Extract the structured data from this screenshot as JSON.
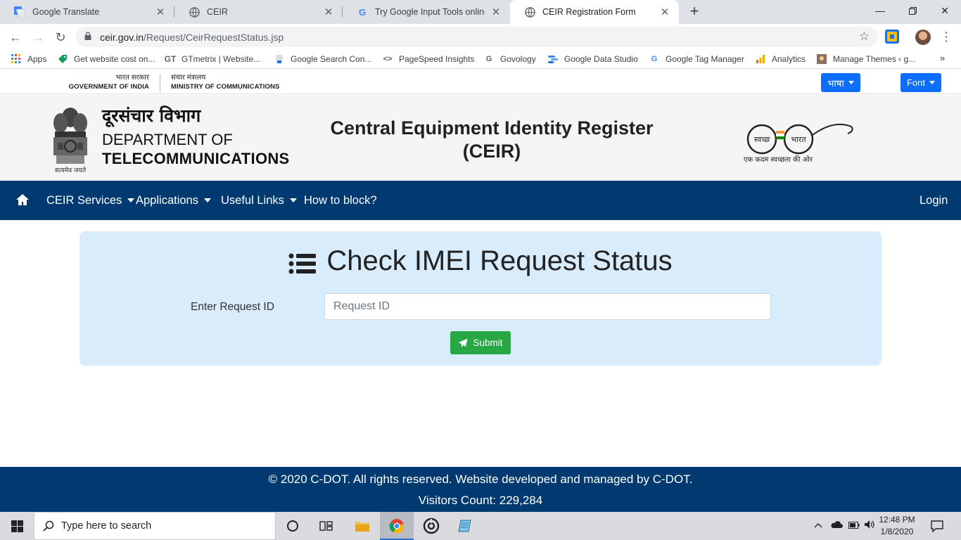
{
  "browser": {
    "tabs": [
      {
        "title": "Google Translate",
        "icon": "google-translate-icon"
      },
      {
        "title": "CEIR",
        "icon": "globe-icon"
      },
      {
        "title": "Try Google Input Tools online – G",
        "icon": "google-icon"
      },
      {
        "title": "CEIR Registration Form",
        "icon": "globe-icon",
        "active": true
      }
    ],
    "url_host": "ceir.gov.in",
    "url_path": "/Request/CeirRequestStatus.jsp",
    "bookmarks": [
      {
        "label": "Apps",
        "icon": "apps-grid-icon"
      },
      {
        "label": "Get website cost on...",
        "icon": "tag-icon"
      },
      {
        "label": "GTmetrix | Website...",
        "icon": "gtmetrix-icon"
      },
      {
        "label": "Google Search Con...",
        "icon": "search-console-icon"
      },
      {
        "label": "PageSpeed Insights",
        "icon": "pagespeed-icon"
      },
      {
        "label": "Govology",
        "icon": "govology-icon"
      },
      {
        "label": "Google Data Studio",
        "icon": "data-studio-icon"
      },
      {
        "label": "Google Tag Manager",
        "icon": "google-icon"
      },
      {
        "label": "Analytics",
        "icon": "analytics-icon"
      },
      {
        "label": "Manage Themes ‹ g...",
        "icon": "themes-icon"
      }
    ]
  },
  "gov": {
    "left_hi": "भारत सरकार",
    "left_en": "GOVERNMENT OF INDIA",
    "right_hi": "संचार मंत्रालय",
    "right_en": "MINISTRY OF COMMUNICATIONS",
    "lang_button": "भाषा",
    "font_button": "Font"
  },
  "header": {
    "dept_hi": "दूरसंचार विभाग",
    "dept_en1": "DEPARTMENT OF",
    "dept_en2": "TELECOMMUNICATIONS",
    "emblem_motto": "सत्यमेव जयते",
    "title_line1": "Central Equipment Identity Register",
    "title_line2": "(CEIR)",
    "swachh_left": "स्वच्छ",
    "swachh_right": "भारत",
    "swachh_tagline": "एक कदम स्वच्छता की ओर"
  },
  "nav": {
    "items": [
      {
        "label": "CEIR Services",
        "dropdown": true
      },
      {
        "label": "Applications",
        "dropdown": true
      },
      {
        "label": "Useful Links",
        "dropdown": true
      },
      {
        "label": "How to block?",
        "dropdown": false
      }
    ],
    "login": "Login"
  },
  "form": {
    "title": "Check IMEI Request Status",
    "label": "Enter Request ID",
    "input_value": "",
    "placeholder": "Request ID",
    "submit": "Submit"
  },
  "footer": {
    "copyright": "© 2020 C-DOT. All rights reserved. Website developed and managed by C-DOT.",
    "visitors": "Visitors Count: 229,284"
  },
  "taskbar": {
    "search_placeholder": "Type here to search",
    "time": "12:48 PM",
    "date": "1/8/2020"
  },
  "colors": {
    "nav_bg": "#003a70",
    "card_bg": "#d8ecfb",
    "submit_bg": "#28a745",
    "dropdown_btn_bg": "#0d6efd"
  }
}
